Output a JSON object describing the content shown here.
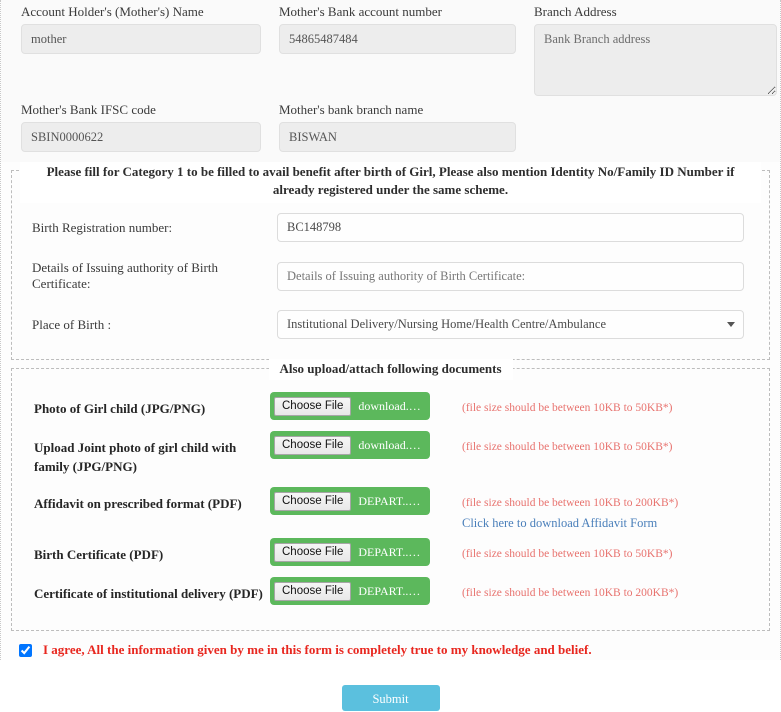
{
  "bank_section": {
    "fields": [
      {
        "label": "Account Holder's (Mother's) Name",
        "value": "mother"
      },
      {
        "label": "Mother's Bank account number",
        "value": "54865487484"
      },
      {
        "label": "Branch Address",
        "placeholder": "Bank Branch address"
      },
      {
        "label": "Mother's Bank IFSC code",
        "value": "SBIN0000622"
      },
      {
        "label": "Mother's bank branch name",
        "value": "BISWAN"
      }
    ]
  },
  "category_section": {
    "legend": "Please fill for Category 1 to be filled to avail benefit after birth of Girl, Please also mention Identity No/Family ID Number if already registered under the same scheme.",
    "rows": [
      {
        "label": "Birth Registration number:",
        "value": "BC148798",
        "type": "text"
      },
      {
        "label": "Details of Issuing authority of Birth Certificate:",
        "placeholder": "Details of Issuing authority of Birth Certificate:",
        "type": "text"
      },
      {
        "label": "Place of Birth :",
        "value": "Institutional Delivery/Nursing Home/Health Centre/Ambulance",
        "type": "select"
      }
    ]
  },
  "upload_section": {
    "legend": "Also upload/attach following documents",
    "choose_file_label": "Choose File",
    "rows": [
      {
        "label": "Photo of Girl child (JPG/PNG)",
        "filename": "download.jpg",
        "hint": "(file size should be between 10KB to 50KB*)"
      },
      {
        "label": "Upload Joint photo of girl child with family (JPG/PNG)",
        "filename": "download.jpg",
        "hint": "(file size should be between 10KB to 50KB*)"
      },
      {
        "label": "Affidavit on prescribed format (PDF)",
        "filename": "DEPART...O.pdf",
        "hint": "(file size should be between 10KB to 200KB*)",
        "link": "Click here to download Affidavit Form"
      },
      {
        "label": "Birth Certificate (PDF)",
        "filename": "DEPART...O.pdf",
        "hint": "(file size should be between 10KB to 50KB*)"
      },
      {
        "label": "Certificate of institutional delivery (PDF)",
        "filename": "DEPART...O.pdf",
        "hint": "(file size should be between 10KB to 200KB*)"
      }
    ]
  },
  "agreement": {
    "checked": true,
    "text": "I agree, All the information given by me in this form is completely true to my knowledge and belief."
  },
  "submit": {
    "label": "Submit"
  },
  "colors": {
    "file_green": "#5cb85c",
    "submit_blue": "#5bc0de",
    "hint_red": "#e8736f",
    "agree_red": "#e8271f",
    "link_blue": "#4a7fba"
  }
}
